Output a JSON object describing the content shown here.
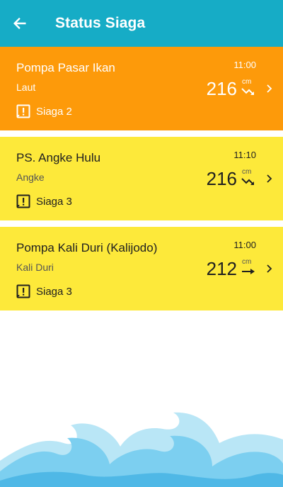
{
  "header": {
    "title": "Status Siaga",
    "back_icon": "arrow-left-icon"
  },
  "colors": {
    "appbar": "#16acc6",
    "siaga2": "#fd9a0a",
    "siaga3": "#fde93a",
    "wave": "#63c5ea"
  },
  "stations": [
    {
      "name": "Pompa Pasar Ikan",
      "river": "Laut",
      "time": "11:00",
      "value": "216",
      "unit": "cm",
      "trend": "falling",
      "status": "Siaga 2",
      "level": 2
    },
    {
      "name": "PS. Angke Hulu",
      "river": "Angke",
      "time": "11:10",
      "value": "216",
      "unit": "cm",
      "trend": "falling",
      "status": "Siaga 3",
      "level": 3
    },
    {
      "name": "Pompa Kali Duri (Kalijodo)",
      "river": "Kali Duri",
      "time": "11:00",
      "value": "212",
      "unit": "cm",
      "trend": "steady",
      "status": "Siaga 3",
      "level": 3
    }
  ]
}
